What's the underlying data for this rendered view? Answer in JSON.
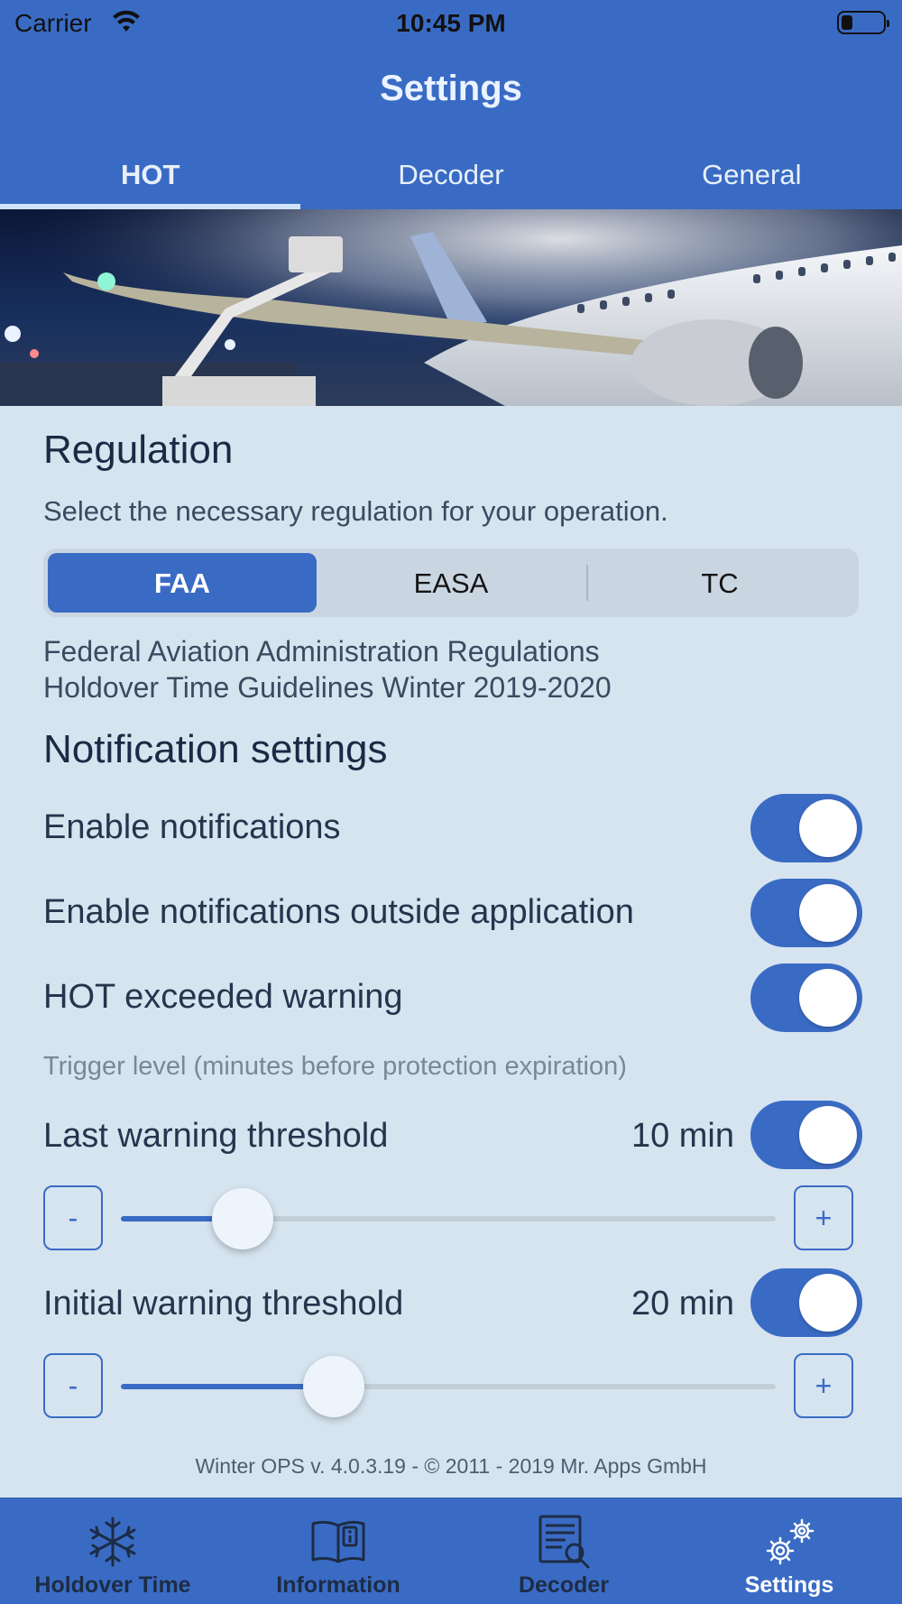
{
  "status_bar": {
    "carrier": "Carrier",
    "time": "10:45 PM"
  },
  "header": {
    "title": "Settings",
    "tabs": [
      {
        "label": "HOT",
        "active": true
      },
      {
        "label": "Decoder",
        "active": false
      },
      {
        "label": "General",
        "active": false
      }
    ]
  },
  "regulation": {
    "title": "Regulation",
    "subtitle": "Select the necessary regulation for your operation.",
    "options": [
      {
        "label": "FAA",
        "selected": true
      },
      {
        "label": "EASA",
        "selected": false
      },
      {
        "label": "TC",
        "selected": false
      }
    ],
    "description_line1": "Federal Aviation Administration Regulations",
    "description_line2": "Holdover Time Guidelines Winter 2019-2020"
  },
  "notifications": {
    "title": "Notification settings",
    "enable_notifications": {
      "label": "Enable notifications",
      "on": true
    },
    "enable_outside": {
      "label": "Enable notifications outside application",
      "on": true
    },
    "hot_exceeded": {
      "label": "HOT exceeded warning",
      "on": true
    },
    "trigger_hint": "Trigger level (minutes before protection expiration)",
    "last_warning": {
      "label": "Last warning threshold",
      "value": "10 min",
      "on": true,
      "slider_fraction": 0.186
    },
    "initial_warning": {
      "label": "Initial warning threshold",
      "value": "20 min",
      "on": true,
      "slider_fraction": 0.325
    },
    "minus_label": "-",
    "plus_label": "+"
  },
  "footer": {
    "text": "Winter OPS v. 4.0.3.19  -  © 2011 - 2019 Mr. Apps GmbH"
  },
  "tabbar": {
    "items": [
      {
        "label": "Holdover Time",
        "icon": "snowflake-icon",
        "active": false
      },
      {
        "label": "Information",
        "icon": "book-icon",
        "active": false
      },
      {
        "label": "Decoder",
        "icon": "document-search-icon",
        "active": false
      },
      {
        "label": "Settings",
        "icon": "gears-icon",
        "active": true
      }
    ]
  },
  "colors": {
    "accent": "#3a6bc4",
    "background": "#d6e4f0"
  }
}
